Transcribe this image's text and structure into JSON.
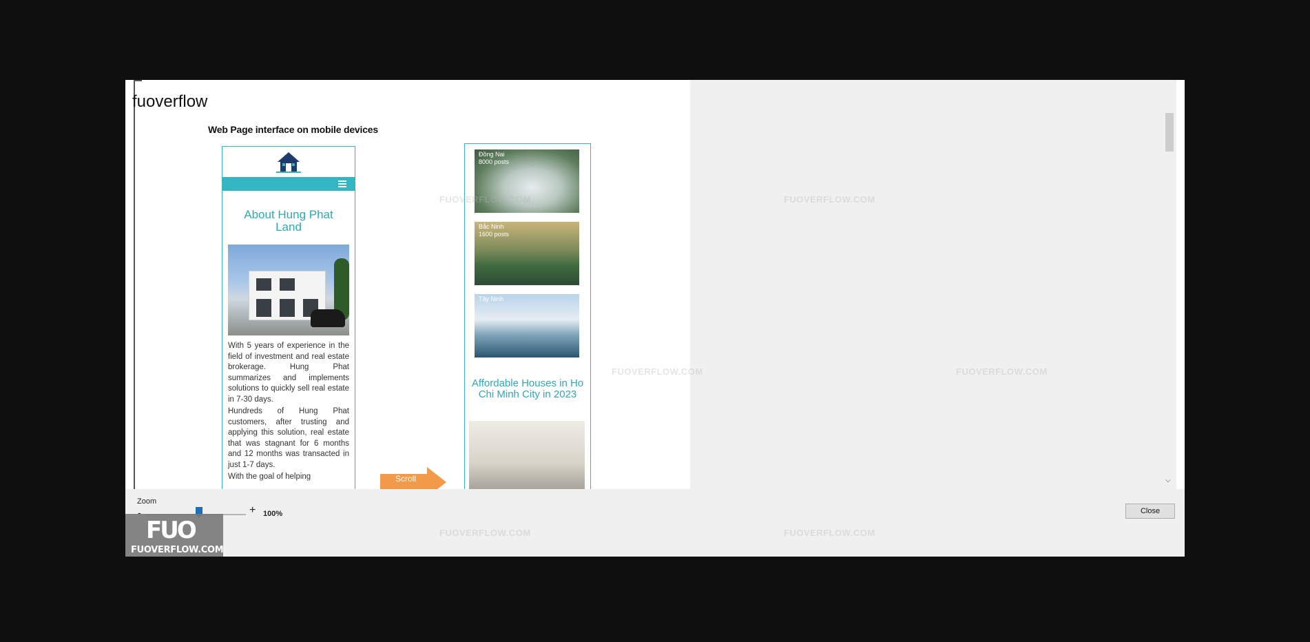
{
  "header": {
    "title": "fuoverflow"
  },
  "document": {
    "heading": "Web Page interface on mobile devices",
    "mobile_page_1": {
      "title": "About Hung Phat Land",
      "paragraphs": [
        "With 5 years of experience in the field of investment and real estate brokerage. Hung Phat summarizes and implements solutions to quickly sell real estate in 7-30 days.",
        "Hundreds of Hung Phat customers, after trusting and applying this solution, real estate that was stagnant for 6 months and 12 months was transacted in just 1-7 days.",
        "With the goal of helping"
      ]
    },
    "mobile_page_2": {
      "thumbnails": [
        {
          "name": "Đồng Nai",
          "count": "8000 posts"
        },
        {
          "name": "Bắc Ninh",
          "count": "1600 posts"
        },
        {
          "name": "Tây Ninh",
          "count": ""
        }
      ],
      "title": "Affordable Houses in Ho Chi Minh City in 2023"
    },
    "scroll_label": "Scroll"
  },
  "watermark": "FUOVERFLOW.COM",
  "zoom": {
    "label": "Zoom",
    "minus": "-",
    "plus": "+",
    "value": "100%",
    "level": 100
  },
  "close_button": "Close",
  "badge": {
    "logo": "FUO",
    "site": "FUOVERFLOW.COM"
  },
  "colors": {
    "accent": "#33b5c2",
    "backdrop": "#0f0f0f",
    "panel": "#f0f0f0",
    "scroll_arrow": "#f29a4a"
  }
}
